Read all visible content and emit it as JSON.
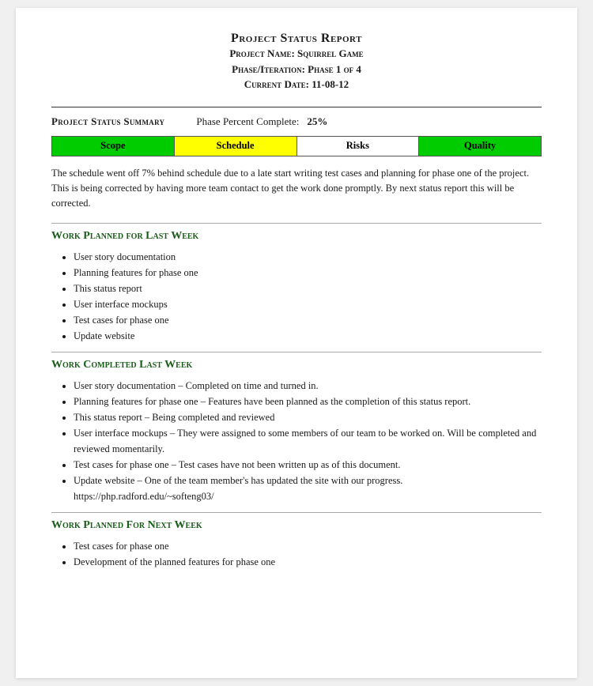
{
  "header": {
    "title": "Project Status Report",
    "project_name_label": "Project Name: Squirrel Game",
    "phase_label": "Phase/Iteration: Phase 1 of 4",
    "date_label": "Current Date: 11-08-12"
  },
  "status_summary": {
    "section_label": "Project Status Summary",
    "phase_percent_label": "Phase Percent Complete:",
    "phase_percent_value": "25%"
  },
  "status_bar": {
    "cells": [
      {
        "label": "Scope",
        "color": "green"
      },
      {
        "label": "Schedule",
        "color": "yellow"
      },
      {
        "label": "Risks",
        "color": "white"
      },
      {
        "label": "Quality",
        "color": "green"
      }
    ]
  },
  "summary_text": "The schedule went off 7% behind schedule due to a late start writing test cases and planning for phase one of the project. This is being corrected by having more team contact to get the work done promptly. By next status report this will be corrected.",
  "work_planned_last_week": {
    "title": "Work Planned for Last Week",
    "items": [
      "User story documentation",
      "Planning features for phase one",
      "This status report",
      "User interface mockups",
      "Test cases for phase one",
      "Update website"
    ]
  },
  "work_completed_last_week": {
    "title": "Work Completed Last Week",
    "items": [
      "User story documentation – Completed on time and turned in.",
      "Planning features for phase one – Features have been planned as the completion of this status report.",
      "This status report – Being completed and reviewed",
      "User interface mockups – They were assigned to some members of our team to be worked on. Will be completed and reviewed momentarily.",
      "Test cases for phase one – Test cases have not been written up as of this document.",
      "Update website – One of the team member's has updated the site with our progress. https://php.radford.edu/~softeng03/"
    ]
  },
  "work_planned_next_week": {
    "title": "Work Planned For Next Week",
    "items": [
      "Test cases for phase one",
      "Development of the planned features for phase one"
    ]
  }
}
